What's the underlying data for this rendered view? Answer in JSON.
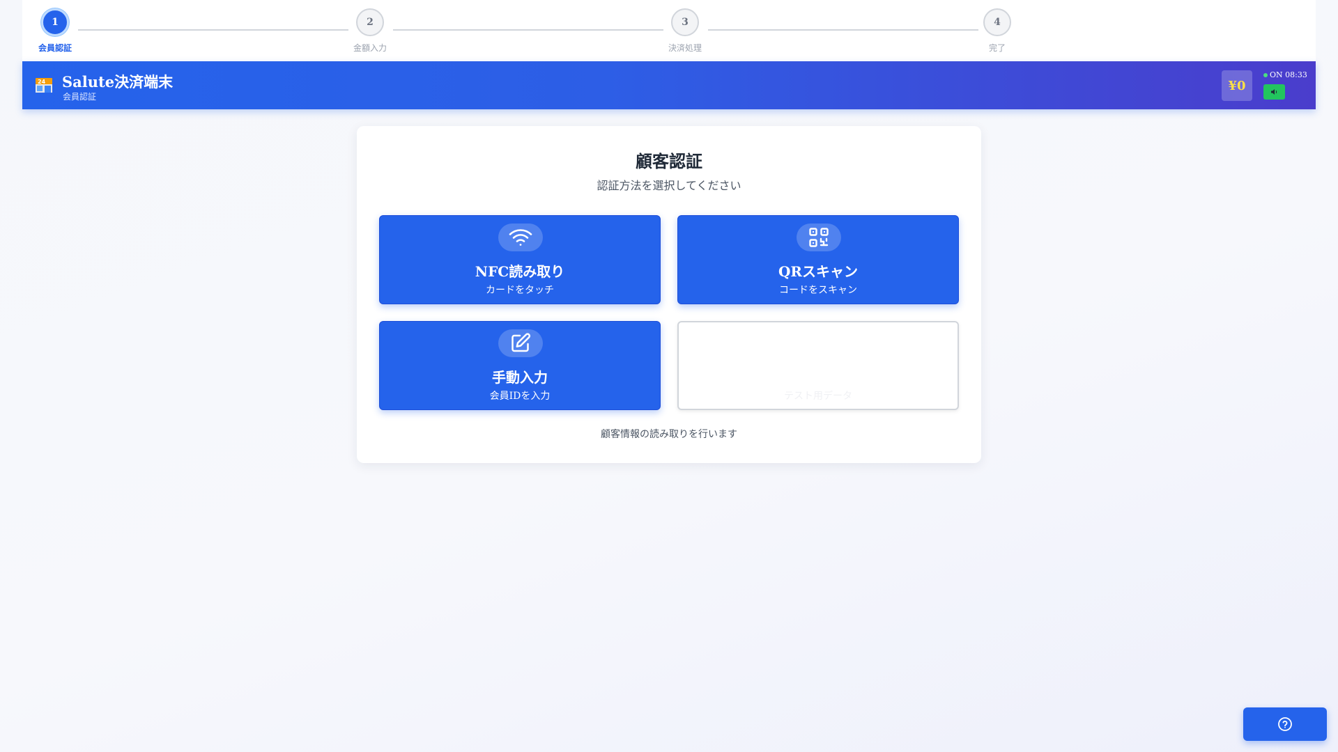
{
  "stepper": {
    "steps": [
      {
        "number": "1",
        "label": "会員認証",
        "active": true
      },
      {
        "number": "2",
        "label": "金額入力",
        "active": false
      },
      {
        "number": "3",
        "label": "決済処理",
        "active": false
      },
      {
        "number": "4",
        "label": "完了",
        "active": false
      }
    ]
  },
  "header": {
    "icon": "store-icon",
    "title": "Salute決済端末",
    "subtitle": "会員認証",
    "balance": "¥0",
    "status": "ON 08:33",
    "sound_icon": "speaker-icon"
  },
  "auth": {
    "title": "顧客認証",
    "subtitle": "認証方法を選択してください",
    "methods": [
      {
        "title": "NFC読み取り",
        "desc": "カードをタッチ",
        "icon": "wifi-icon"
      },
      {
        "title": "QRスキャン",
        "desc": "コードをスキャン",
        "icon": "qr-code-icon"
      },
      {
        "title": "手動入力",
        "desc": "会員IDを入力",
        "icon": "edit-icon"
      },
      {
        "title": "",
        "desc": "テスト用データ",
        "icon": ""
      }
    ],
    "footer": "顧客情報の読み取りを行います"
  },
  "help": {
    "icon": "help-circle-icon"
  },
  "colors": {
    "primary": "#2563eb",
    "header_gradient_end": "#4a3dcc",
    "status_green": "#22c55e",
    "balance_yellow": "#fde047"
  }
}
